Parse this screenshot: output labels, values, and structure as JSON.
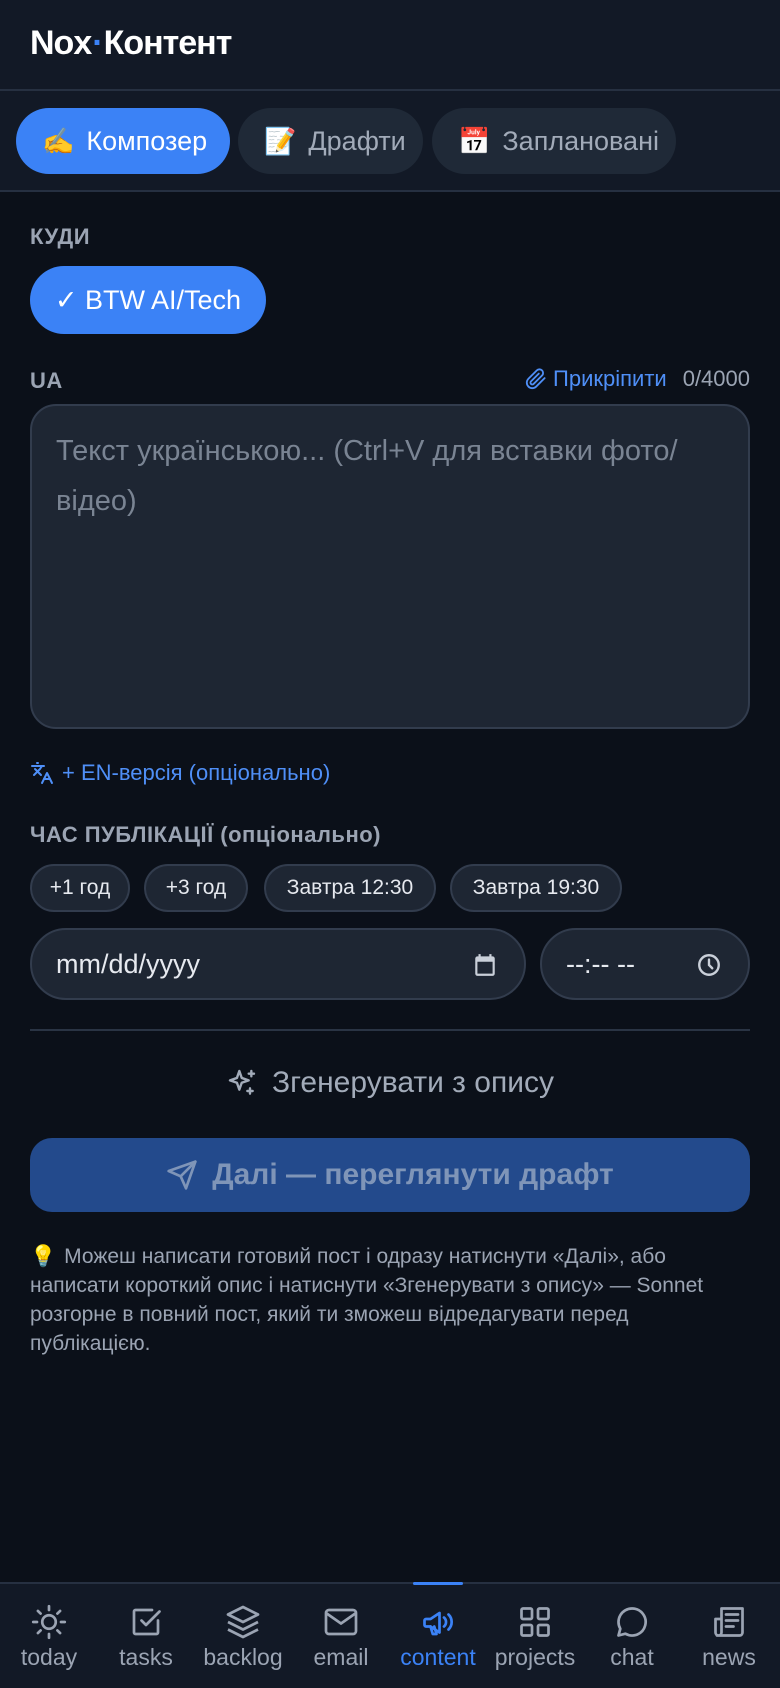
{
  "app": {
    "brand_left": "Nox",
    "brand_dot": "·",
    "brand_right": "Контент"
  },
  "tabs": [
    {
      "emoji": "✍️",
      "label": "Композер",
      "active": true
    },
    {
      "emoji": "📝",
      "label": "Драфти",
      "active": false
    },
    {
      "emoji": "📅",
      "label": "Заплановані",
      "active": false
    }
  ],
  "destination": {
    "label": "КУДИ",
    "chip": "✓ BTW AI/Tech"
  },
  "ua_section": {
    "label": "UA",
    "attach_label": "Прикріпити",
    "char_count": "0/4000",
    "placeholder": "Текст українською... (Ctrl+V для вставки фото/відео)"
  },
  "en_link": "+ EN-версія (опціонально)",
  "publish_time": {
    "label": "ЧАС ПУБЛІКАЦІЇ (опціонально)",
    "quick_options": [
      "+1 год",
      "+3 год",
      "Завтра 12:30",
      "Завтра 19:30"
    ],
    "date_placeholder": "mm/dd/yyyy",
    "time_placeholder": "--:-- --"
  },
  "generate_label": "Згенерувати з опису",
  "next_button": "Далі — переглянути драфт",
  "hint": {
    "icon": "💡",
    "text": "Можеш написати готовий пост і одразу натиснути «Далі», або написати короткий опис і натиснути «Згенерувати з опису» — Sonnet розгорне в повний пост, який ти зможеш відредагувати перед публікацією."
  },
  "bottom_nav": [
    {
      "label": "today",
      "icon": "sun-icon",
      "active": false
    },
    {
      "label": "tasks",
      "icon": "checkbox-icon",
      "active": false
    },
    {
      "label": "backlog",
      "icon": "layers-icon",
      "active": false
    },
    {
      "label": "email",
      "icon": "mail-icon",
      "active": false
    },
    {
      "label": "content",
      "icon": "megaphone-icon",
      "active": true
    },
    {
      "label": "projects",
      "icon": "grid-icon",
      "active": false
    },
    {
      "label": "chat",
      "icon": "chat-bubble-icon",
      "active": false
    },
    {
      "label": "news",
      "icon": "newspaper-icon",
      "active": false
    }
  ],
  "colors": {
    "background": "#0b1019",
    "panel": "#121926",
    "accent": "#3b82f6",
    "field": "#1e2633",
    "muted_text": "#9ba4b3"
  }
}
